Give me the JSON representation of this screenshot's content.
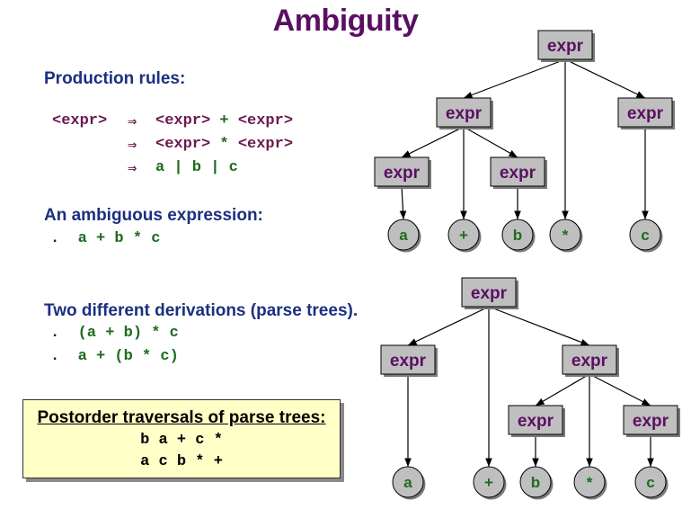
{
  "title": "Ambiguity",
  "production": {
    "heading": "Production rules:",
    "rules": [
      {
        "lhs": "<expr>",
        "arrow": "⇒",
        "rhs": [
          {
            "t": "<expr>",
            "k": "nt"
          },
          {
            "t": " + ",
            "k": "tm"
          },
          {
            "t": "<expr>",
            "k": "nt"
          }
        ]
      },
      {
        "lhs": "",
        "arrow": "⇒",
        "rhs": [
          {
            "t": "<expr>",
            "k": "nt"
          },
          {
            "t": " * ",
            "k": "tm"
          },
          {
            "t": "<expr>",
            "k": "nt"
          }
        ]
      },
      {
        "lhs": "",
        "arrow": "⇒",
        "rhs": [
          {
            "t": "a | b | c",
            "k": "tm"
          }
        ]
      }
    ]
  },
  "ambiguous": {
    "heading": "An ambiguous expression:",
    "items": [
      "a + b * c"
    ]
  },
  "derivations": {
    "heading": "Two different derivations (parse trees).",
    "items": [
      "(a + b) * c",
      "a + (b * c)"
    ]
  },
  "postorder": {
    "heading": "Postorder traversals of parse trees:",
    "lines": [
      "b a + c *",
      "a c b * +"
    ]
  },
  "colors": {
    "node_fill": "#bfbfbf",
    "node_text": "#5b0f63",
    "leaf_text": "#1f6b1f",
    "edge": "#000000"
  },
  "tree1": {
    "nodes": [
      {
        "id": "r",
        "label": "expr",
        "kind": "box"
      },
      {
        "id": "l",
        "label": "expr",
        "kind": "box"
      },
      {
        "id": "rr",
        "label": "expr",
        "kind": "box"
      },
      {
        "id": "ll",
        "label": "expr",
        "kind": "box"
      },
      {
        "id": "lr",
        "label": "expr",
        "kind": "box"
      },
      {
        "id": "a",
        "label": "a",
        "kind": "leaf"
      },
      {
        "id": "plus",
        "label": "+",
        "kind": "leaf"
      },
      {
        "id": "b",
        "label": "b",
        "kind": "leaf"
      },
      {
        "id": "star",
        "label": "*",
        "kind": "leaf"
      },
      {
        "id": "c",
        "label": "c",
        "kind": "leaf"
      }
    ],
    "edges": [
      [
        "r",
        "l"
      ],
      [
        "r",
        "star"
      ],
      [
        "r",
        "rr"
      ],
      [
        "l",
        "ll"
      ],
      [
        "l",
        "plus"
      ],
      [
        "l",
        "lr"
      ],
      [
        "ll",
        "a"
      ],
      [
        "lr",
        "b"
      ],
      [
        "rr",
        "c"
      ]
    ]
  },
  "tree2": {
    "nodes": [
      {
        "id": "r",
        "label": "expr",
        "kind": "box"
      },
      {
        "id": "l",
        "label": "expr",
        "kind": "box"
      },
      {
        "id": "rr",
        "label": "expr",
        "kind": "box"
      },
      {
        "id": "rl",
        "label": "expr",
        "kind": "box"
      },
      {
        "id": "rrr",
        "label": "expr",
        "kind": "box"
      },
      {
        "id": "a",
        "label": "a",
        "kind": "leaf"
      },
      {
        "id": "plus",
        "label": "+",
        "kind": "leaf"
      },
      {
        "id": "b",
        "label": "b",
        "kind": "leaf"
      },
      {
        "id": "star",
        "label": "*",
        "kind": "leaf"
      },
      {
        "id": "c",
        "label": "c",
        "kind": "leaf"
      }
    ],
    "edges": [
      [
        "r",
        "l"
      ],
      [
        "r",
        "plus"
      ],
      [
        "r",
        "rr"
      ],
      [
        "l",
        "a"
      ],
      [
        "rr",
        "rl"
      ],
      [
        "rr",
        "star"
      ],
      [
        "rr",
        "rrr"
      ],
      [
        "rl",
        "b"
      ],
      [
        "rrr",
        "c"
      ]
    ]
  }
}
